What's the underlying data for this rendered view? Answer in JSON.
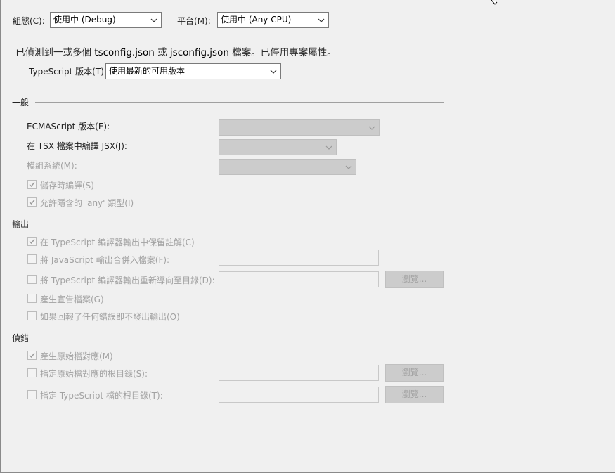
{
  "header": {
    "config_label": "組態(C):",
    "config_value": "使用中 (Debug)",
    "platform_label": "平台(M):",
    "platform_value": "使用中 (Any CPU)"
  },
  "notice": {
    "text_a": "已偵測到一或多個 ",
    "file1": "tsconfig.json",
    "text_b": " 或 ",
    "file2": "jsconfig.json",
    "text_c": " 檔案。已停用專案屬性。"
  },
  "ts_version": {
    "label": "TypeScript 版本(T):",
    "value": "使用最新的可用版本"
  },
  "general": {
    "title": "一般",
    "ecma_label": "ECMAScript 版本(E):",
    "jsx_label": "在 TSX 檔案中編譯 JSX(J):",
    "module_label": "模組系統(M):",
    "compile_on_save": "儲存時編譯(S)",
    "implicit_any": "允許隱含的 'any' 類型(I)"
  },
  "output": {
    "title": "輸出",
    "keep_comments": "在 TypeScript 編譯器輸出中保留註解(C)",
    "combine_js": "將 JavaScript 輸出合併入檔案(F):",
    "redirect_output": "將 TypeScript 編譯器輸出重新導向至目錄(D):",
    "browse": "瀏覽...",
    "gen_declarations": "產生宣告檔案(G)",
    "no_emit_on_error": "如果回報了任何錯誤即不發出輸出(O)"
  },
  "debug": {
    "title": "偵錯",
    "gen_source_maps": "產生原始檔對應(M)",
    "map_root": "指定原始檔對應的根目錄(S):",
    "browse1": "瀏覽...",
    "source_root": "指定 TypeScript 檔的根目錄(T):",
    "browse2": "瀏覽..."
  },
  "icons": {
    "dropdown": "chevron-down-icon",
    "checkbox_checked": "checkmark-icon",
    "cursor": "mouse-cursor-icon"
  },
  "colors": {
    "background": "#f0f0f0",
    "disabled_text": "#a2a2a2",
    "disabled_control": "#cccccc"
  }
}
